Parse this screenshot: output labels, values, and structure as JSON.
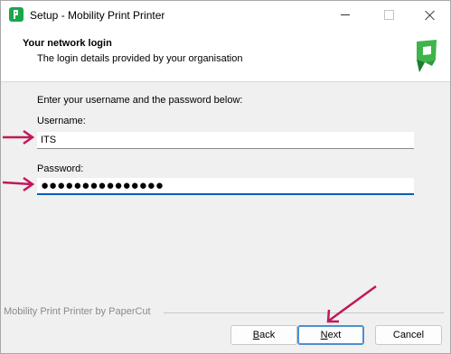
{
  "window": {
    "title": "Setup - Mobility Print Printer"
  },
  "header": {
    "title": "Your network login",
    "subtitle": "The login details provided by your organisation"
  },
  "form": {
    "intro": "Enter your username and the password below:",
    "username_label": "Username:",
    "username_value": "ITS",
    "password_label": "Password:",
    "password_mask": "●●●●●●●●●●●●●●●"
  },
  "footer": {
    "brand": "Mobility Print Printer by PaperCut"
  },
  "buttons": {
    "back_access": "B",
    "back_rest": "ack",
    "next_access": "N",
    "next_rest": "ext",
    "cancel": "Cancel"
  },
  "colors": {
    "accent_blue": "#005fb8",
    "annotation_arrow": "#c2185b",
    "logo_green": "#1ca64a"
  }
}
